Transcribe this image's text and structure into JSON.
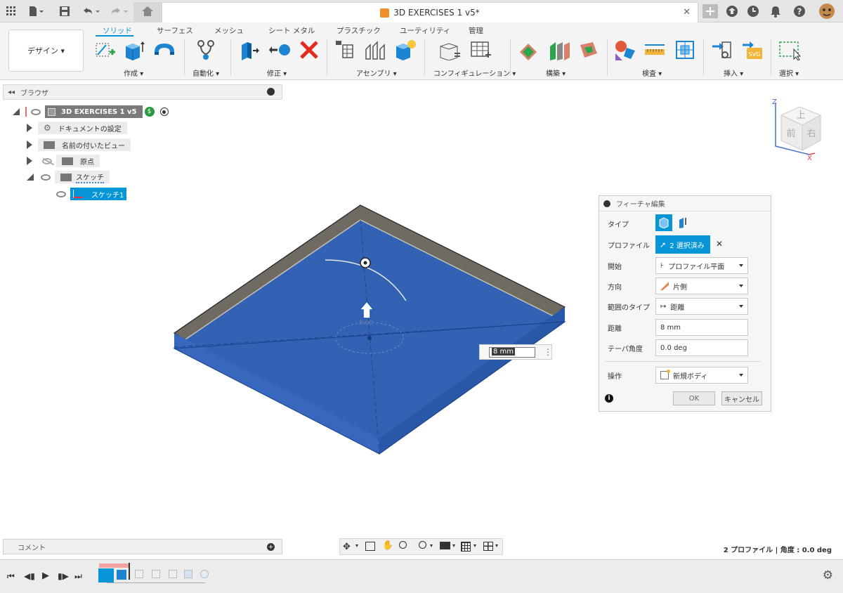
{
  "window": {
    "title": "3D EXERCISES 1 v5*"
  },
  "workspace_button": "デザイン ▾",
  "ribbon": {
    "tabs": [
      "ソリッド",
      "サーフェス",
      "メッシュ",
      "シート メタル",
      "プラスチック",
      "ユーティリティ",
      "管理"
    ],
    "groups": [
      "作成 ▾",
      "自動化 ▾",
      "修正 ▾",
      "アセンブリ ▾",
      "コンフィギュレーション ▾",
      "構築 ▾",
      "検査 ▾",
      "挿入 ▾",
      "選択 ▾"
    ]
  },
  "browser": {
    "title": "ブラウザ",
    "items": {
      "root": "3D EXERCISES 1 v5",
      "doc_settings": "ドキュメントの設定",
      "named_views": "名前の付いたビュー",
      "origin": "原点",
      "sketches": "スケッチ",
      "sketch1": "スケッチ1"
    }
  },
  "viewcube": {
    "top": "上",
    "front": "前",
    "right": "右",
    "axis_z": "Z",
    "axis_x": "X"
  },
  "viewport": {
    "dimension_value": "8 mm",
    "dim_hint": "8.00"
  },
  "feature_panel": {
    "title": "フィーチャ編集",
    "type_label": "タイプ",
    "profile_label": "プロファイル",
    "profile_value": "2 選択済み",
    "start_label": "開始",
    "start_value": "プロファイル平面",
    "direction_label": "方向",
    "direction_value": "片側",
    "extent_label": "範囲のタイプ",
    "extent_value": "距離",
    "distance_label": "距離",
    "distance_value": "8 mm",
    "taper_label": "テーパ角度",
    "taper_value": "0.0 deg",
    "operation_label": "操作",
    "operation_value": "新規ボディ",
    "ok": "OK",
    "cancel": "キャンセル"
  },
  "comment_bar": {
    "label": "コメント"
  },
  "status": "2 プロファイル | 角度 : 0.0 deg",
  "colors": {
    "accent": "#0696d7",
    "body_blue": "#2f62b8",
    "plate_gray": "#6f6a62"
  }
}
